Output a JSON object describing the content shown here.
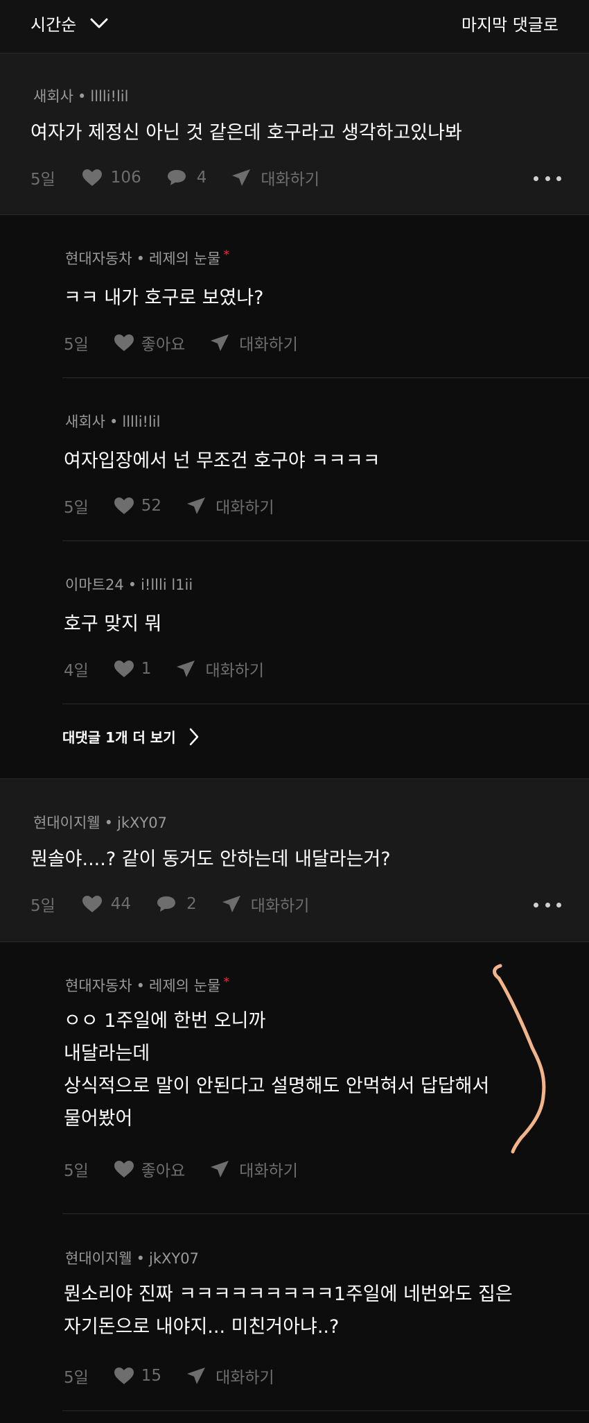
{
  "toolbar": {
    "sort_label": "시간순",
    "last_comment_label": "마지막 댓글로"
  },
  "actions": {
    "chat_label": "대화하기",
    "like_label": "좋아요"
  },
  "comments": [
    {
      "company": "새회사",
      "nickname": "lllli!lil",
      "text": "여자가 제정신 아닌 것 같은데 호구라고 생각하고있나봐",
      "age": "5일",
      "likes": "106",
      "replies": "4"
    },
    {
      "company": "현대이지웰",
      "nickname": "jkXY07",
      "text": "뭔솔야....? 같이 동거도 안하는데 내달라는거?",
      "age": "5일",
      "likes": "44",
      "replies": "2"
    }
  ],
  "replies_group1": [
    {
      "company": "현대자동차",
      "nickname": "레제의 눈물",
      "star": "*",
      "text": "ㅋㅋ 내가 호구로 보였나?",
      "age": "5일"
    },
    {
      "company": "새회사",
      "nickname": "lllli!lil",
      "text": "여자입장에서 넌 무조건 호구야 ㅋㅋㅋㅋ",
      "age": "5일",
      "likes": "52"
    },
    {
      "company": "이마트24",
      "nickname": "i!llli l1ii",
      "text": "호구 맞지 뭐",
      "age": "4일",
      "likes": "1"
    }
  ],
  "see_more_label": "대댓글 1개 더 보기",
  "replies_group2": [
    {
      "company": "현대자동차",
      "nickname": "레제의 눈물",
      "star": "*",
      "lines": [
        "ㅇㅇ 1주일에 한번 오니까",
        "내달라는데",
        "상식적으로 말이 안된다고 설명해도 안먹혀서 답답해서",
        "물어봤어"
      ],
      "age": "5일"
    },
    {
      "company": "현대이지웰",
      "nickname": "jkXY07",
      "lines": [
        "뭔소리야 진짜 ㅋㅋㅋㅋㅋㅋㅋㅋㅋ1주일에 네번와도 집은",
        "자기돈으로 내야지... 미친거아냐..?"
      ],
      "age": "5일",
      "likes": "15"
    }
  ],
  "colors": {
    "background": "#121212",
    "comment_bg": "#1a1a1a",
    "reply_bg": "#0d0d0d",
    "muted": "#6e6e6e",
    "star": "#e0323c",
    "annotation": "#f2b48a"
  }
}
